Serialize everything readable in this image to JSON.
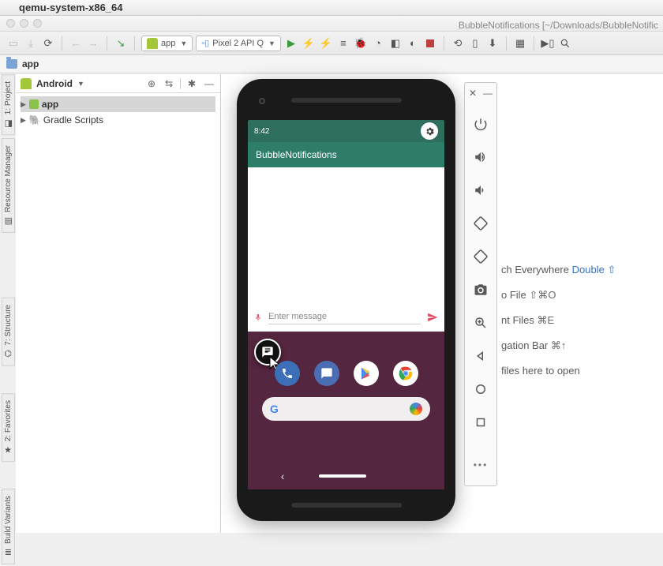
{
  "mac": {
    "app_name": "qemu-system-x86_64"
  },
  "window": {
    "title": "BubbleNotifications [~/Downloads/BubbleNotific"
  },
  "toolbar": {
    "config_label": "app",
    "device_label": "Pixel 2 API Q"
  },
  "breadcrumb": {
    "segment": "app"
  },
  "side_tabs": {
    "project": "1: Project",
    "resource_manager": "Resource Manager",
    "structure": "7: Structure",
    "favorites": "2: Favorites",
    "build_variants": "Build Variants"
  },
  "project_panel": {
    "mode": "Android",
    "tree": {
      "app": "app",
      "gradle": "Gradle Scripts"
    }
  },
  "tips": {
    "search": {
      "label": "ch Everywhere",
      "link": "Double",
      "shortcut": "⇧"
    },
    "goto": {
      "label": "o File",
      "shortcut": "⇧⌘O"
    },
    "recent": {
      "label": "nt Files",
      "shortcut": "⌘E"
    },
    "navbar": {
      "label": "gation Bar",
      "shortcut": "⌘↑"
    },
    "drop": {
      "label": "files here to open"
    }
  },
  "emulator": {
    "status_time": "8:42",
    "app_title": "BubbleNotifications",
    "input_placeholder": "Enter message",
    "google_g": "G"
  }
}
